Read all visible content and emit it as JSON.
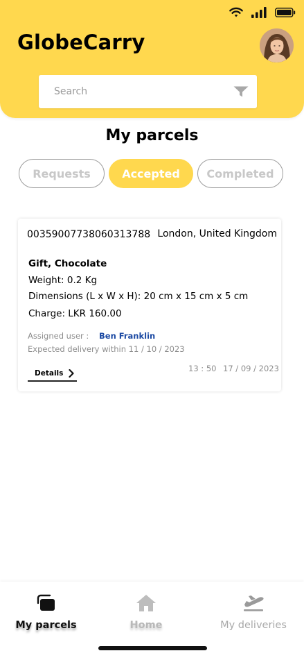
{
  "app": {
    "title": "GlobeCarry"
  },
  "search": {
    "placeholder": "Search"
  },
  "page": {
    "title": "My parcels"
  },
  "tabs": [
    {
      "label": "Requests",
      "active": false
    },
    {
      "label": "Accepted",
      "active": true
    },
    {
      "label": "Completed",
      "active": false
    }
  ],
  "parcel": {
    "tracking": "00359007738060313788",
    "location": "London, United Kingdom",
    "item": "Gift, Chocolate",
    "weight": "Weight: 0.2 Kg",
    "dimensions": "Dimensions (L x W x H): 20 cm x 15 cm x 5 cm",
    "charge": "Charge: LKR 160.00",
    "assigned_label": "Assigned user :",
    "assigned_user": "Ben Franklin",
    "expected": "Expected delivery within  11 / 10 / 2023",
    "time": "13 : 50",
    "date": "17 / 09 / 2023",
    "details_label": "Details"
  },
  "nav": [
    {
      "label": "My parcels",
      "icon": "parcel-box-icon",
      "active": true
    },
    {
      "label": "Home",
      "icon": "home-icon",
      "active": false
    },
    {
      "label": "My deliveries",
      "icon": "plane-departure-icon",
      "active": false
    }
  ],
  "colors": {
    "accent": "#ffd84e",
    "link": "#1c4aa3",
    "muted": "#8d8d8d"
  }
}
